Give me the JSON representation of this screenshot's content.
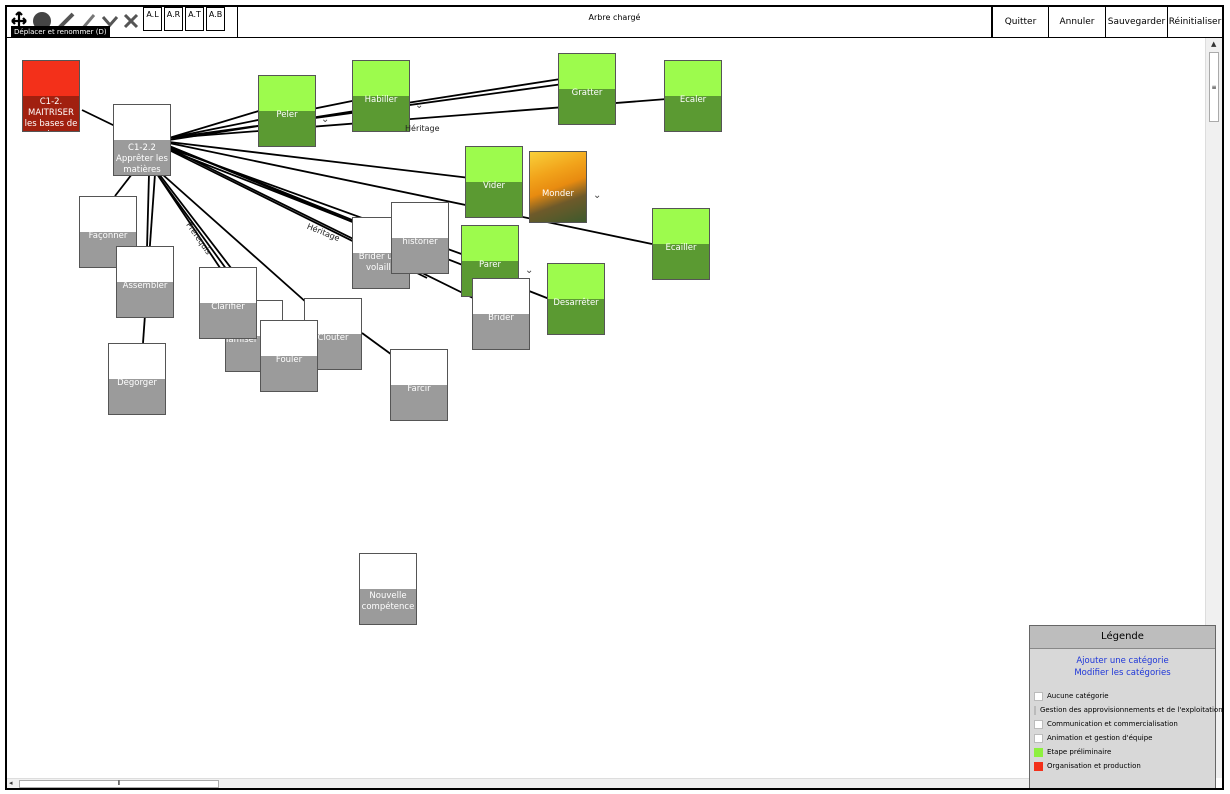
{
  "toolbar": {
    "tooltip": "Déplacer et renommer (D)",
    "align_buttons": [
      "A.L",
      "A.R",
      "A.T",
      "A.B"
    ],
    "status": "Arbre chargé",
    "actions": [
      "Quitter",
      "Annuler",
      "Sauvegarder",
      "Réinitialiser"
    ]
  },
  "nodes": {
    "maitriser": "C1-2. MAITRISER les bases de la",
    "apprecier": "C1-2.2 Apprêter les matières",
    "peler": "Peler",
    "habiller": "Habiller",
    "gratter": "Gratter",
    "ecaler": "Ecaler",
    "vider": "Vider",
    "monder": "Monder",
    "ecailler": "Ecailler",
    "faconner": "Façonner",
    "assembler": "Assembler",
    "degorger": "Dégorger",
    "clarifier": "Clarifier",
    "tamiser": "Tamiser",
    "fouler": "Fouler",
    "clouter": "Clouter",
    "farcir": "Farcir",
    "brider_volaille": "Brider une volaille",
    "historier": "historier",
    "parer": "Parer",
    "brider": "Brider",
    "desarreter": "Desarrêter",
    "nouvelle": "Nouvelle compétence"
  },
  "edge_labels": {
    "heritage_1": "Héritage",
    "heritage_2": "Héritage",
    "prerequis": "Prérequis"
  },
  "legend": {
    "title": "Légende",
    "add_category": "Ajouter une catégorie",
    "edit_categories": "Modifier les catégories",
    "items": [
      {
        "label": "Aucune catégorie",
        "color": "#ffffff"
      },
      {
        "label": "Gestion des approvisionnements et de l'exploitation",
        "color": "#ffffff"
      },
      {
        "label": "Communication et commercialisation",
        "color": "#ffffff"
      },
      {
        "label": "Animation et gestion d'équipe",
        "color": "#ffffff"
      },
      {
        "label": "Etape préliminaire",
        "color": "#8ef03f"
      },
      {
        "label": "Organisation et production",
        "color": "#f3301a"
      }
    ]
  },
  "colors": {
    "green_top": "#9dfb4d",
    "green_bottom": "#5b9a32",
    "red_top": "#f3301a",
    "red_bottom": "#a1200f",
    "white_bottom": "#9b9b9b",
    "link_blue": "#1e36d8"
  }
}
